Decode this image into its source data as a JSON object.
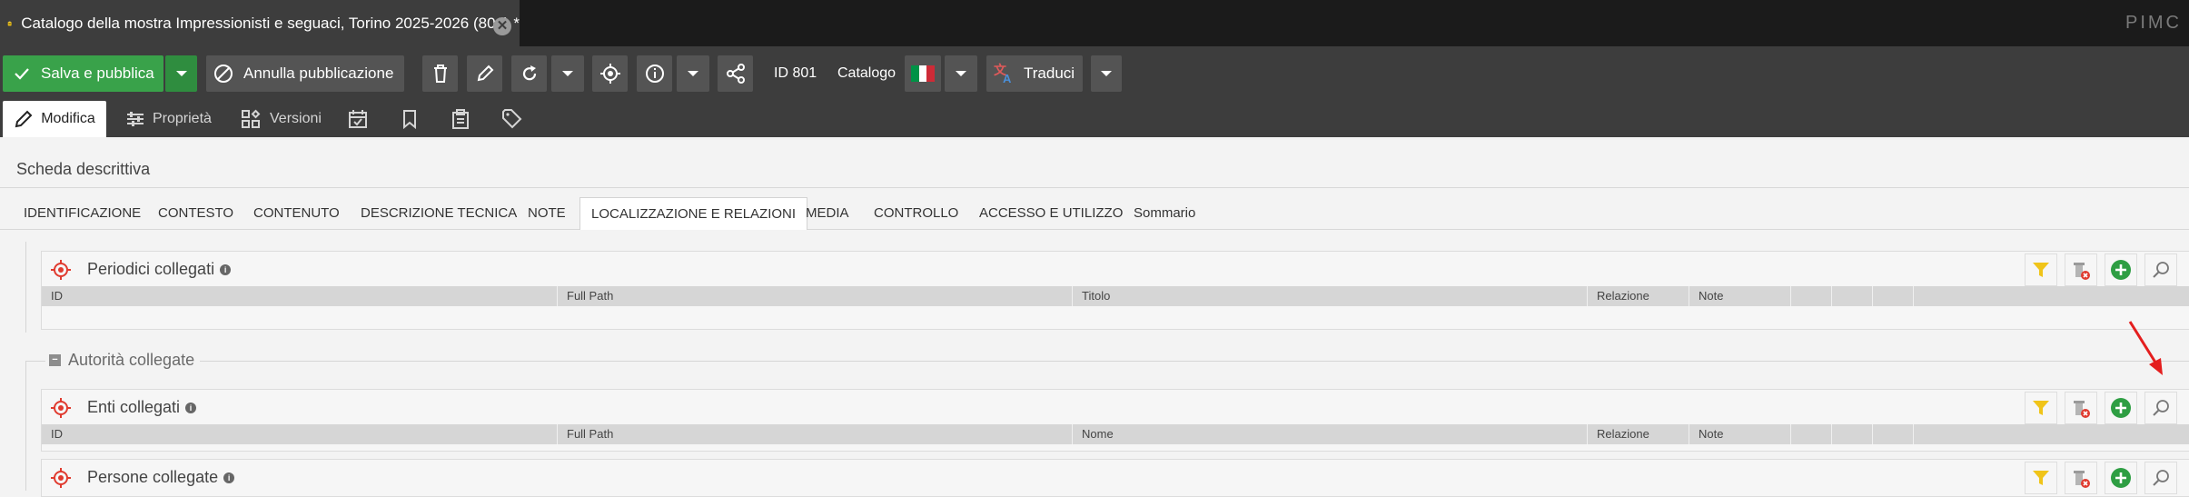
{
  "window": {
    "doc_title": "Catalogo della mostra Impressionisti e seguaci, Torino 2025-2026 (801) *",
    "close_glyph": "✕",
    "brand": "PIMC"
  },
  "toolbar": {
    "save_label": "Salva e pubblica",
    "unpublish_label": "Annulla pubblicazione",
    "id_label": "ID 801",
    "class_label": "Catalogo",
    "translate_label": "Traduci"
  },
  "subtabs": {
    "edit": "Modifica",
    "properties": "Proprietà",
    "versions": "Versioni"
  },
  "layout_title": "Scheda descrittiva",
  "tabs": [
    "IDENTIFICAZIONE",
    "CONTESTO",
    "CONTENUTO",
    "DESCRIZIONE TECNICA",
    "NOTE",
    "LOCALIZZAZIONE E RELAZIONI",
    "MEDIA",
    "CONTROLLO",
    "ACCESSO E UTILIZZO",
    "Sommario"
  ],
  "active_tab": "LOCALIZZAZIONE E RELAZIONI",
  "panels": {
    "periodici": {
      "title": "Periodici collegati",
      "info": "i",
      "columns": [
        "ID",
        "Full Path",
        "Titolo",
        "Relazione",
        "Note"
      ]
    },
    "fieldset_title": "Autorità collegate",
    "fieldset_toggle": "−",
    "enti": {
      "title": "Enti collegati",
      "info": "i",
      "columns": [
        "ID",
        "Full Path",
        "Nome",
        "Relazione",
        "Note"
      ]
    },
    "persone": {
      "title": "Persone collegate",
      "info": "i"
    }
  },
  "colors": {
    "accent_green": "#39a24a",
    "toolbar_bg": "#3d3d3d",
    "target_red": "#e03b2f",
    "annotation_arrow": "#e41e1e"
  }
}
